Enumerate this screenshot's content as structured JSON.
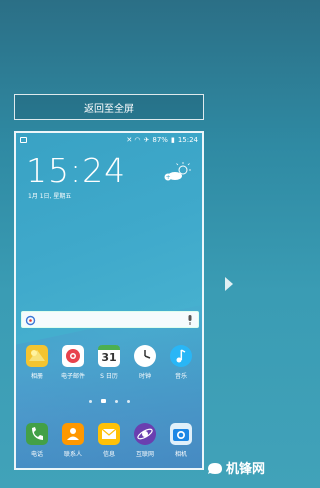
{
  "overlay": {
    "return_button": "返回至全屏"
  },
  "statusbar": {
    "battery": "87%",
    "time": "15:24"
  },
  "lockscreen": {
    "clock": "15:24",
    "date": "1月 1日, 星期五"
  },
  "dock_row1": [
    {
      "label": "相册",
      "icon": "gallery-icon",
      "color": "#f3c52b"
    },
    {
      "label": "电子邮件",
      "icon": "email-icon",
      "color": "#e8434d"
    },
    {
      "label": "S 日历",
      "icon": "calendar-icon",
      "color": "#4caf50",
      "day": "31"
    },
    {
      "label": "时钟",
      "icon": "clock-icon",
      "color": "#ffffff"
    },
    {
      "label": "音乐",
      "icon": "music-icon",
      "color": "#29b6f6"
    }
  ],
  "dock_row2": [
    {
      "label": "电话",
      "icon": "phone-icon",
      "color": "#43a047"
    },
    {
      "label": "联系人",
      "icon": "contacts-icon",
      "color": "#ff9800"
    },
    {
      "label": "信息",
      "icon": "messages-icon",
      "color": "#ffc107"
    },
    {
      "label": "互联网",
      "icon": "internet-icon",
      "color": "#6a3fb0"
    },
    {
      "label": "相机",
      "icon": "camera-icon",
      "color": "#e0f0fa"
    }
  ],
  "watermark": {
    "brand": "机锋网"
  }
}
